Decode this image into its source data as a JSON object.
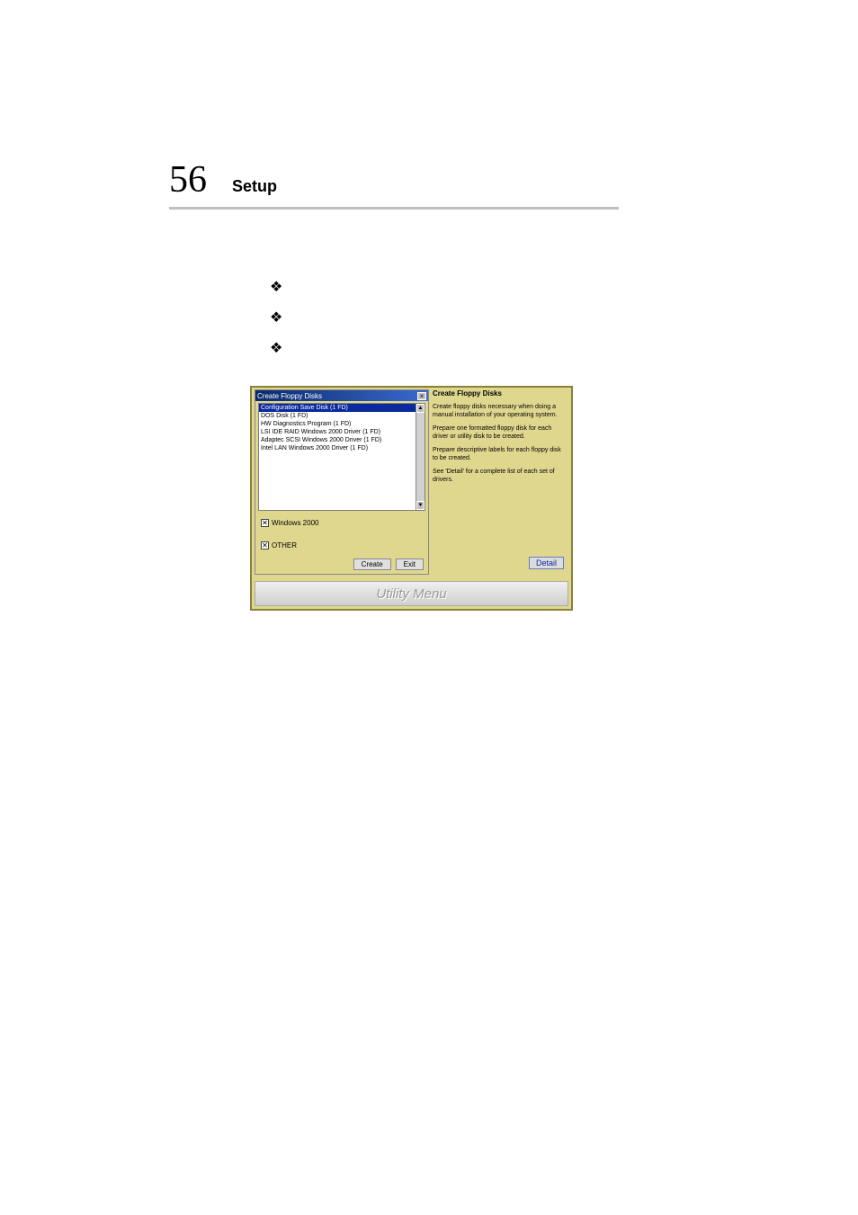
{
  "header": {
    "page_number": "56",
    "section_title": "Setup"
  },
  "bullets": [
    "❖",
    "❖",
    "❖"
  ],
  "dialog": {
    "title": "Create Floppy Disks",
    "close_glyph": "×",
    "list_items": [
      "Configuration Save Disk (1 FD)",
      "DOS Disk (1 FD)",
      "HW Diagnostics Program (1 FD)",
      "LSI IDE RAID Windows 2000 Driver (1 FD)",
      "Adaptec SCSI Windows 2000 Driver (1 FD)",
      "Intel LAN Windows 2000 Driver (1 FD)"
    ],
    "selected_index": 0,
    "checkbox1": {
      "label": "Windows 2000",
      "checked": true
    },
    "checkbox2": {
      "label": "OTHER",
      "checked": true
    },
    "create_label": "Create",
    "exit_label": "Exit",
    "scroll_up": "▲",
    "scroll_down": "▼"
  },
  "info": {
    "title": "Create Floppy Disks",
    "p1": "Create floppy disks necessary when doing a manual installation of your operating system.",
    "p2": "Prepare one formatted floppy disk for each driver or utility disk to be created.",
    "p3": "Prepare descriptive labels for each floppy disk to be created.",
    "p4": "See 'Detail' for a complete list of each set of drivers.",
    "detail_label": "Detail"
  },
  "utility_bar": "Utility Menu"
}
